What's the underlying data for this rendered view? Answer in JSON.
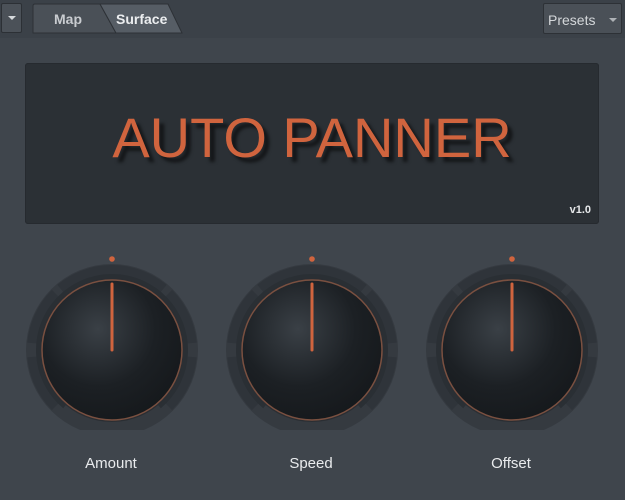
{
  "toolbar": {
    "menu_icon": "chevron-down-icon",
    "tabs": [
      {
        "label": "Map",
        "active": false
      },
      {
        "label": "Surface",
        "active": true
      }
    ],
    "presets_label": "Presets"
  },
  "panel": {
    "title": "AUTO PANNER",
    "version": "v1.0"
  },
  "knobs": [
    {
      "label": "Amount",
      "value": 0.5
    },
    {
      "label": "Speed",
      "value": 0.5
    },
    {
      "label": "Offset",
      "value": 0.5
    }
  ],
  "colors": {
    "accent": "#d0643e",
    "background": "#3f454c",
    "panel": "#2b3035",
    "text": "#e9ebed"
  }
}
